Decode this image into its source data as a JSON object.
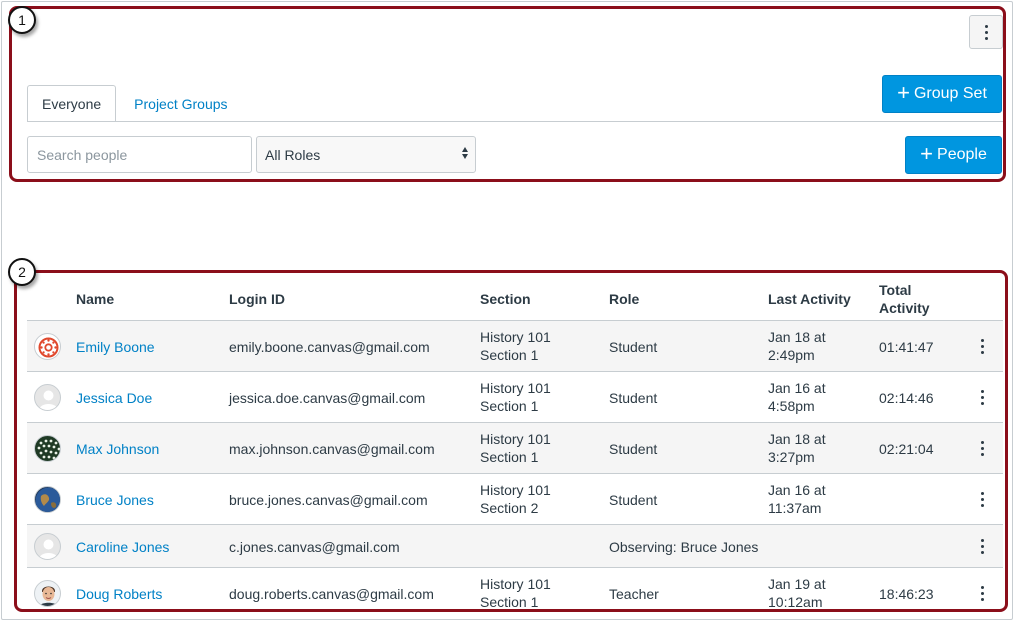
{
  "callouts": {
    "one": "1",
    "two": "2"
  },
  "toolbar": {
    "tabs": [
      {
        "label": "Everyone"
      },
      {
        "label": "Project Groups"
      }
    ],
    "group_set_label": "Group Set",
    "people_label": "People",
    "search_placeholder": "Search people",
    "roles_selected": "All Roles"
  },
  "table": {
    "headers": {
      "name": "Name",
      "login": "Login ID",
      "section": "Section",
      "role": "Role",
      "last_activity": "Last Activity",
      "total_activity_1": "Total",
      "total_activity_2": "Activity"
    },
    "rows": [
      {
        "name": "Emily Boone",
        "login": "emily.boone.canvas@gmail.com",
        "section_1": "History 101",
        "section_2": "Section 1",
        "role": "Student",
        "last_1": "Jan 18 at",
        "last_2": "2:49pm",
        "total": "01:41:47"
      },
      {
        "name": "Jessica Doe",
        "login": "jessica.doe.canvas@gmail.com",
        "section_1": "History 101",
        "section_2": "Section 1",
        "role": "Student",
        "last_1": "Jan 16 at",
        "last_2": "4:58pm",
        "total": "02:14:46"
      },
      {
        "name": "Max Johnson",
        "login": "max.johnson.canvas@gmail.com",
        "section_1": "History 101",
        "section_2": "Section 1",
        "role": "Student",
        "last_1": "Jan 18 at",
        "last_2": "3:27pm",
        "total": "02:21:04"
      },
      {
        "name": "Bruce Jones",
        "login": "bruce.jones.canvas@gmail.com",
        "section_1": "History 101",
        "section_2": "Section 2",
        "role": "Student",
        "last_1": "Jan 16 at",
        "last_2": "11:37am",
        "total": ""
      },
      {
        "name": "Caroline Jones",
        "login": "c.jones.canvas@gmail.com",
        "section_1": "",
        "section_2": "",
        "role": "Observing: Bruce Jones",
        "last_1": "",
        "last_2": "",
        "total": ""
      },
      {
        "name": "Doug Roberts",
        "login": "doug.roberts.canvas@gmail.com",
        "section_1": "History 101",
        "section_2": "Section 1",
        "role": "Teacher",
        "last_1": "Jan 19 at",
        "last_2": "10:12am",
        "total": "18:46:23"
      }
    ]
  },
  "colors": {
    "accent": "#0096e0",
    "link": "#0081c6",
    "callout": "#8b0e1a"
  }
}
